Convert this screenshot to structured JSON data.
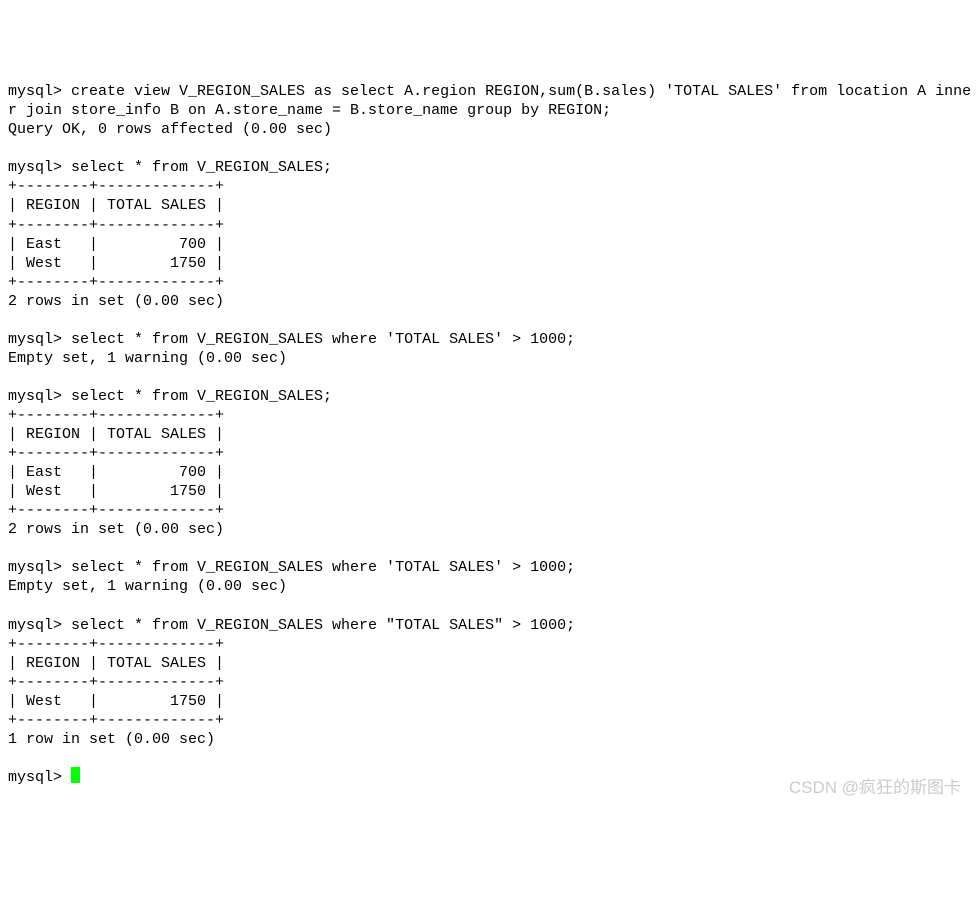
{
  "terminal": {
    "lines": {
      "l0": "mysql> create view V_REGION_SALES as select A.region REGION,sum(B.sales) 'TOTAL SALES' from location A inne",
      "l1": "r join store_info B on A.store_name = B.store_name group by REGION;",
      "l2": "Query OK, 0 rows affected (0.00 sec)",
      "l3": "",
      "l4": "mysql> select * from V_REGION_SALES;",
      "l5": "+--------+-------------+",
      "l6": "| REGION | TOTAL SALES |",
      "l7": "+--------+-------------+",
      "l8": "| East   |         700 |",
      "l9": "| West   |        1750 |",
      "l10": "+--------+-------------+",
      "l11": "2 rows in set (0.00 sec)",
      "l12": "",
      "l13": "mysql> select * from V_REGION_SALES where 'TOTAL SALES' > 1000;",
      "l14": "Empty set, 1 warning (0.00 sec)",
      "l15": "",
      "l16": "mysql> select * from V_REGION_SALES;",
      "l17": "+--------+-------------+",
      "l18": "| REGION | TOTAL SALES |",
      "l19": "+--------+-------------+",
      "l20": "| East   |         700 |",
      "l21": "| West   |        1750 |",
      "l22": "+--------+-------------+",
      "l23": "2 rows in set (0.00 sec)",
      "l24": "",
      "l25": "mysql> select * from V_REGION_SALES where 'TOTAL SALES' > 1000;",
      "l26": "Empty set, 1 warning (0.00 sec)",
      "l27": "",
      "l28": "mysql> select * from V_REGION_SALES where \"TOTAL SALES\" > 1000;",
      "l29": "+--------+-------------+",
      "l30": "| REGION | TOTAL SALES |",
      "l31": "+--------+-------------+",
      "l32": "| West   |        1750 |",
      "l33": "+--------+-------------+",
      "l34": "1 row in set (0.00 sec)",
      "l35": "",
      "l36": "mysql> "
    }
  },
  "watermark": "CSDN @疯狂的斯图卡"
}
